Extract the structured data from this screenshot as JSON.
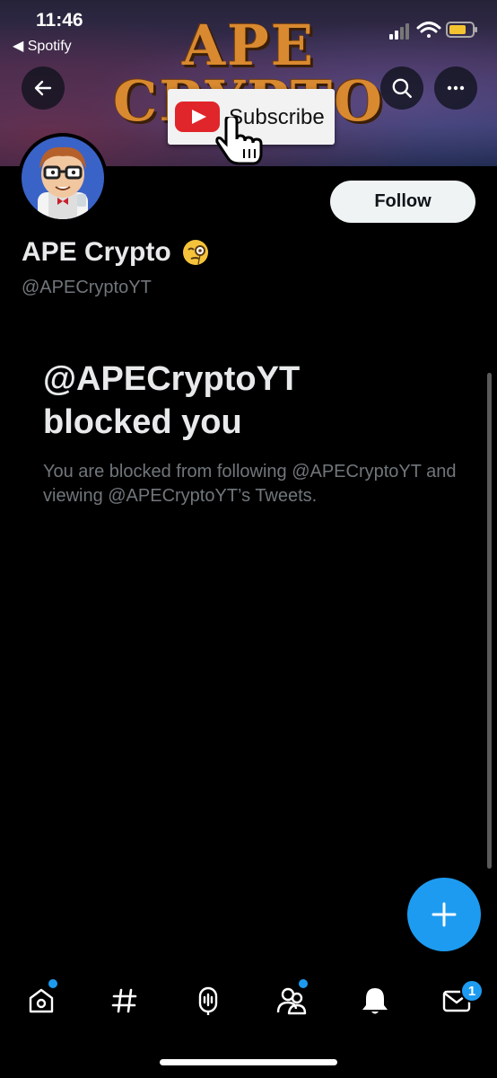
{
  "status_bar": {
    "time": "11:46",
    "back_app": "◀ Spotify"
  },
  "banner": {
    "title": "APE CRYPTO",
    "subscribe_label": "Subscribe"
  },
  "profile": {
    "display_name": "APE Crypto",
    "handle": "@APECryptoYT",
    "follow_label": "Follow"
  },
  "blocked": {
    "title": "@APECryptoYT blocked you",
    "description": "You are blocked from following @APECryptoYT and viewing @APECryptoYT’s Tweets."
  },
  "tabbar": {
    "items": [
      {
        "name": "home",
        "icon": "home-icon",
        "has_dot": true
      },
      {
        "name": "explore",
        "icon": "hashtag-icon",
        "has_dot": false
      },
      {
        "name": "spaces",
        "icon": "microphone-icon",
        "has_dot": false
      },
      {
        "name": "communities",
        "icon": "people-icon",
        "has_dot": true
      },
      {
        "name": "notifications",
        "icon": "bell-icon",
        "has_dot": false
      },
      {
        "name": "messages",
        "icon": "mail-icon",
        "badge": "1"
      }
    ]
  },
  "colors": {
    "accent": "#1d9bf0",
    "background": "#000000",
    "secondary_text": "#71767b"
  }
}
